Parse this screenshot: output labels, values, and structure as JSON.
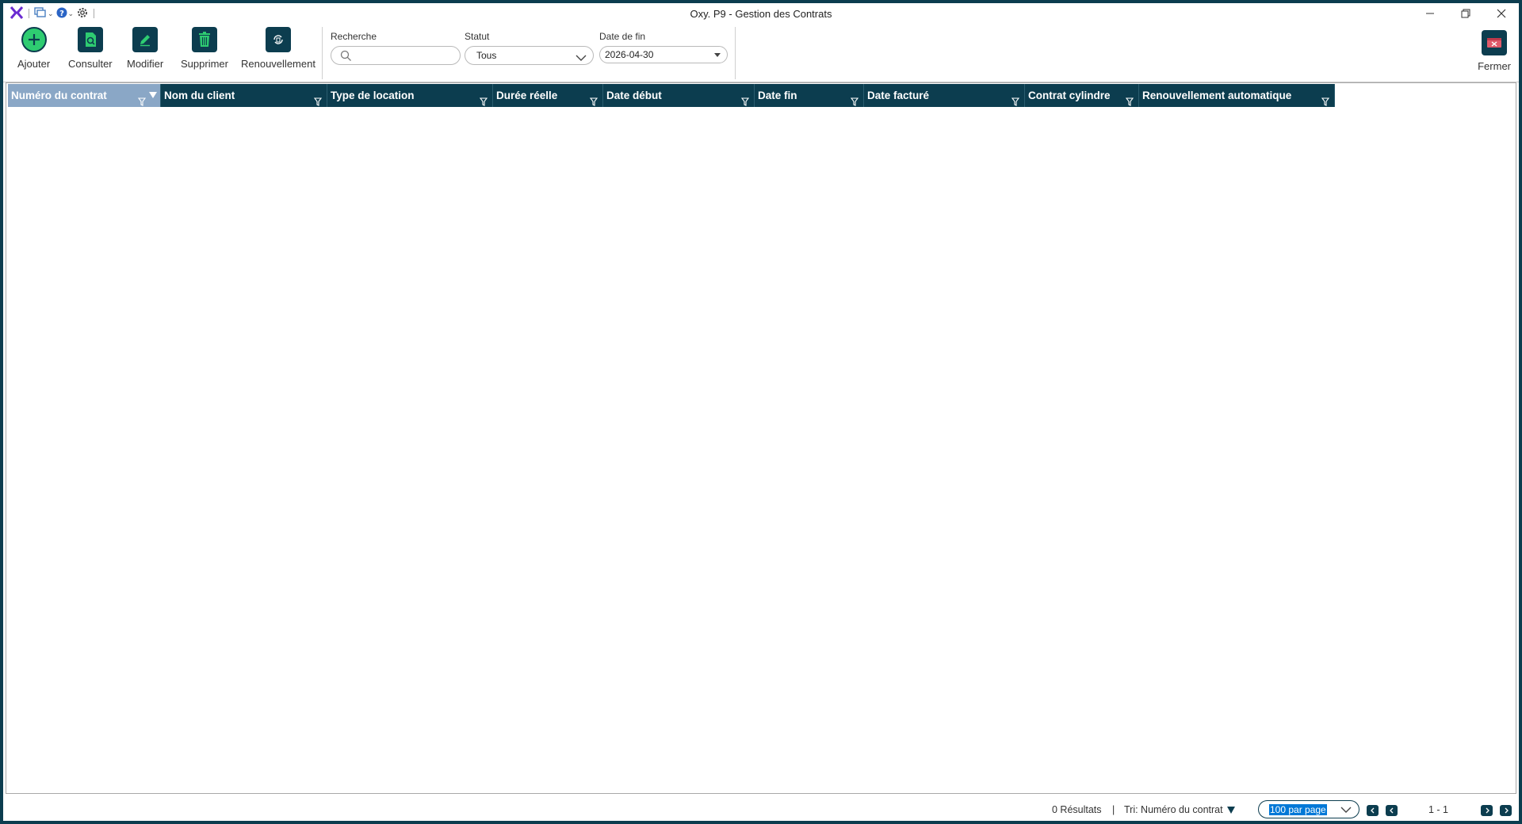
{
  "window": {
    "title": "Oxy. P9 - Gestion des Contrats"
  },
  "toolbar": {
    "add_label": "Ajouter",
    "view_label": "Consulter",
    "edit_label": "Modifier",
    "delete_label": "Supprimer",
    "renew_label": "Renouvellement",
    "close_label": "Fermer"
  },
  "filters": {
    "search_label": "Recherche",
    "search_value": "",
    "status_label": "Statut",
    "status_value": "Tous",
    "enddate_label": "Date de fin",
    "enddate_value": "2026-04-30"
  },
  "grid": {
    "columns": [
      "Numéro du contrat",
      "Nom du client",
      "Type de location",
      "Durée réelle",
      "Date début",
      "Date fin",
      "Date facturé",
      "Contrat cylindre",
      "Renouvellement automatique"
    ],
    "rows": []
  },
  "status": {
    "results": "0 Résultats",
    "separator": "|",
    "sort": "Tri: Numéro du contrat",
    "page_size": "100 par page",
    "page_range": "1 - 1"
  },
  "colors": {
    "accent": "#0c3d4f",
    "active_column": "#8aa7c6",
    "add_green": "#2ecc71"
  }
}
